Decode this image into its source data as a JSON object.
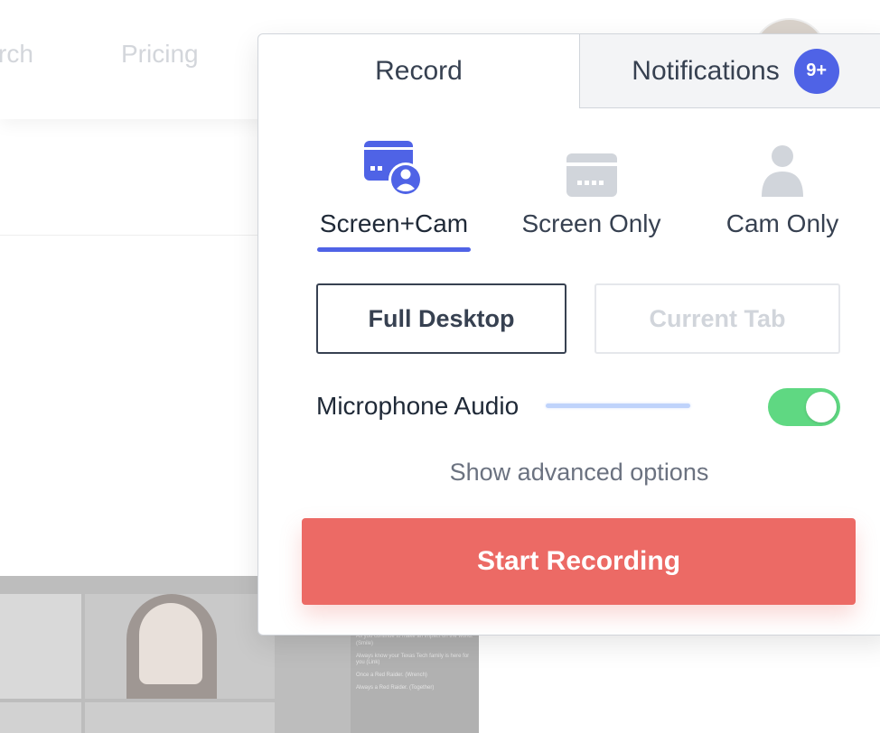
{
  "background": {
    "nav_links": [
      "rch",
      "Pricing"
    ],
    "chat_lines": [
      "As you continue to make an impact on the world. (Smile)",
      "Always know your Texas Tech family is here for you (Link)",
      "Once a Red Raider. (Wrench)",
      "Always a Red Raider. (Together)"
    ]
  },
  "popup": {
    "tabs": [
      {
        "label": "Record",
        "active": true
      },
      {
        "label": "Notifications",
        "active": false,
        "badge": "9+"
      }
    ],
    "modes": [
      {
        "label": "Screen+Cam",
        "icon": "screen-cam-icon",
        "active": true
      },
      {
        "label": "Screen Only",
        "icon": "screen-icon",
        "active": false
      },
      {
        "label": "Cam Only",
        "icon": "person-icon",
        "active": false
      }
    ],
    "capture_options": [
      {
        "label": "Full Desktop",
        "selected": true
      },
      {
        "label": "Current Tab",
        "selected": false
      }
    ],
    "microphone": {
      "label": "Microphone Audio",
      "enabled": true
    },
    "advanced_link": "Show advanced options",
    "start_button": "Start Recording"
  },
  "colors": {
    "accent": "#4f63e6",
    "toggle_on": "#5fd882",
    "start": "#ec6a65",
    "inactive_icon": "#d1d5db"
  }
}
